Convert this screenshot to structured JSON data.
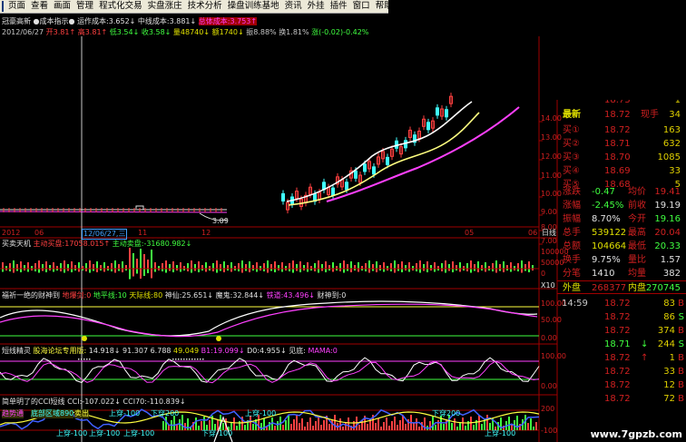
{
  "menubar": {
    "items": [
      "页面",
      "查看",
      "画面",
      "管理",
      "程式化交易",
      "实盘涨庄",
      "技术分析",
      "操盘训练基地",
      "资讯",
      "外挂",
      "插件",
      "窗口",
      "帮助"
    ]
  },
  "main_chart": {
    "title_row": {
      "name": "冠豪高新",
      "indicator": "●成本指示●",
      "label1": "运作成本:3.652↓",
      "label2": "中线成本:3.881↓",
      "label3": "总体成本:3.753↑"
    },
    "info_row": {
      "date": "2012/06/27",
      "open": "开3.81↑",
      "high": "高3.81↑",
      "low": "低3.54↓",
      "close": "收3.58↓",
      "volume": "量48740↓",
      "amount": "额1740↓",
      "amplitude": "振8.88%",
      "turnover": "换1.81%",
      "change": "涨(-0.02)-0.42%"
    },
    "right_axis": [
      "14.00",
      "13.00",
      "12.00",
      "11.00",
      "10.00",
      "9.00",
      "8.00",
      "7.00"
    ],
    "low_label": "3.09"
  },
  "time_axis": {
    "labels": [
      "2012",
      "06",
      "12/06/27,三",
      "11",
      "12",
      "05",
      "06",
      "日线"
    ]
  },
  "volume_panel": {
    "title": "买卖天机",
    "buy_label": "主动买盘:17058.015↑",
    "sell_label": "主动卖盘:-31680.982↓",
    "axis": [
      "100000",
      "50000",
      "0"
    ],
    "unit": "X10"
  },
  "wealth_panel": {
    "title": "福祈一绝的财神到",
    "l1": "地爆剑:0",
    "l2": "地平线:10",
    "l3": "天际线:80",
    "l4": "神仙:25.651↓",
    "l5": "魔鬼:32.844↓",
    "l6": "铁道:43.496↓",
    "l7": "财神到:0",
    "axis": [
      "100.00",
      "50.00",
      "0.00"
    ]
  },
  "short_panel": {
    "title": "短线精灵",
    "subtitle": "股海论坛专用版:",
    "v1": "14.918↓",
    "v2": "91.307",
    "v3": "6.788",
    "v4": "49.049",
    "v5": "B1:19.099↓",
    "v6": "D0:4.955↓",
    "v7": "见底:",
    "v8": "MAMA:0",
    "axis": [
      "100.00",
      "0.00"
    ]
  },
  "cci_panel": {
    "title": "简单明了的CCI短线",
    "cci": "CCI:-107.022↓",
    "cci70": "CCI70:-110.839↓",
    "labels": [
      "趋势通",
      "底部区域890",
      "卖出",
      "上穿-100",
      "下穿200",
      "上穿-100",
      "下穿200",
      "上穿-100",
      "上穿-100",
      "上穿-100",
      "下穿-100",
      "上穿-100"
    ],
    "axis": [
      "200",
      "-100"
    ]
  },
  "quote_panel": {
    "partial_top": {
      "price": "18.73",
      "vol": "1"
    },
    "latest": {
      "label": "最新",
      "price": "18.72",
      "label2": "现手",
      "vol": "34"
    },
    "buys": [
      {
        "label": "买①",
        "price": "18.72",
        "vol": "163"
      },
      {
        "label": "买②",
        "price": "18.71",
        "vol": "632"
      },
      {
        "label": "买③",
        "price": "18.70",
        "vol": "1085"
      },
      {
        "label": "买④",
        "price": "18.69",
        "vol": "33"
      },
      {
        "label": "买⑤",
        "price": "18.68",
        "vol": "5"
      }
    ],
    "stats": [
      {
        "l1": "涨跌",
        "v1": "-0.47",
        "l2": "均价",
        "v2": "19.41"
      },
      {
        "l1": "涨幅",
        "v1": "-2.45%",
        "l2": "前收",
        "v2": "19.19"
      },
      {
        "l1": "振幅",
        "v1": "8.70%",
        "l2": "今开",
        "v2": "19.16"
      },
      {
        "l1": "总手",
        "v1": "539122",
        "l2": "最高",
        "v2": "20.04"
      },
      {
        "l1": "总额",
        "v1": "104664",
        "l2": "最低",
        "v2": "20.33"
      },
      {
        "l1": "换手",
        "v1": "9.75%",
        "l2": "量比",
        "v2": "1.57"
      },
      {
        "l1": "分笔",
        "v1": "1410",
        "l2": "均量",
        "v2": "382"
      }
    ],
    "outer": {
      "label": "外盘",
      "value": "268377",
      "label2": "内盘",
      "value2": "270745"
    },
    "ticks": [
      {
        "time": "14:59",
        "price": "18.72",
        "vol": "83",
        "flag": "B"
      },
      {
        "time": "",
        "price": "18.72",
        "vol": "86",
        "flag": "S"
      },
      {
        "time": "",
        "price": "18.72",
        "vol": "374",
        "flag": "B"
      },
      {
        "time": "",
        "price": "18.71",
        "vol": "244",
        "flag": "S"
      },
      {
        "time": "",
        "price": "18.72",
        "vol": "1",
        "flag": "B"
      },
      {
        "time": "",
        "price": "18.72",
        "vol": "33",
        "flag": "B"
      },
      {
        "time": "",
        "price": "18.72",
        "vol": "12",
        "flag": "B"
      },
      {
        "time": "",
        "price": "18.72",
        "vol": "72",
        "flag": "B"
      }
    ]
  },
  "watermark": "www.7gpzb.com"
}
